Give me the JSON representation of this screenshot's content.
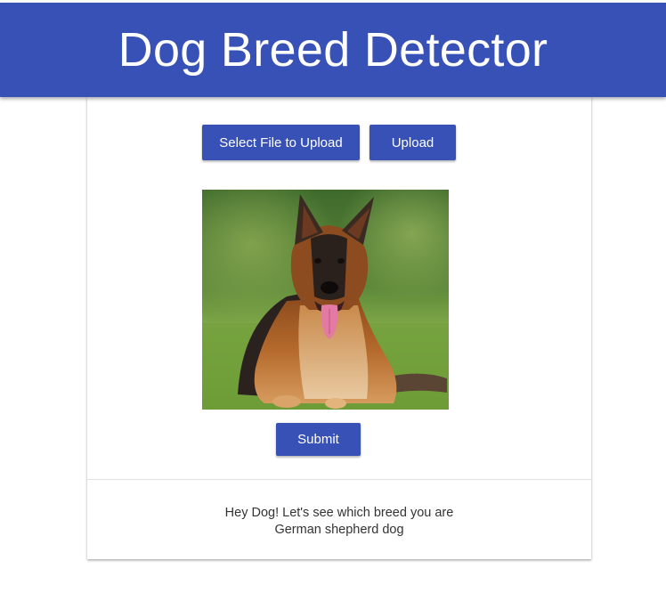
{
  "header": {
    "title": "Dog Breed Detector"
  },
  "actions": {
    "select_file_label": "Select File to Upload",
    "upload_label": "Upload",
    "submit_label": "Submit"
  },
  "preview": {
    "alt": "German shepherd dog lying on grass"
  },
  "result": {
    "greeting": "Hey Dog! Let's see which breed you are",
    "breed": "German shepherd dog"
  },
  "colors": {
    "primary": "#3851b6",
    "text": "#333333",
    "background": "#ffffff"
  }
}
